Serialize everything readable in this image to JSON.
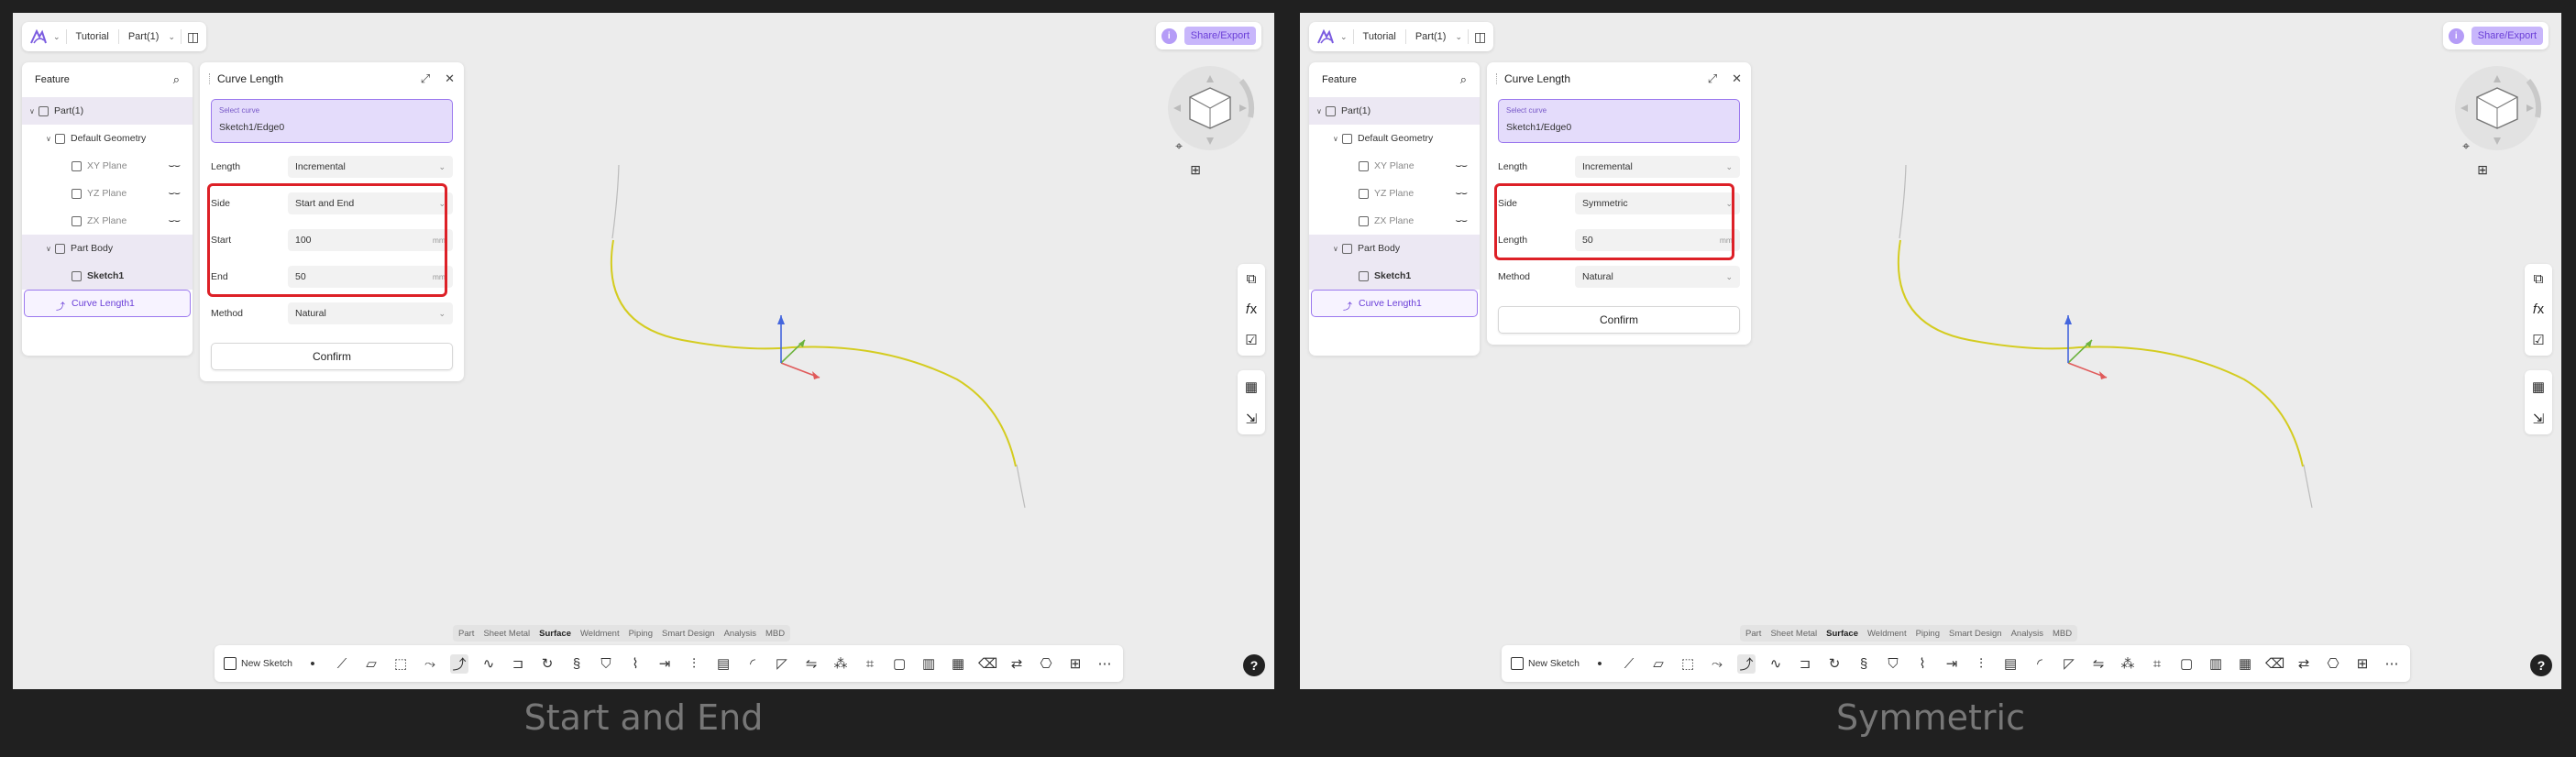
{
  "colors": {
    "accent": "#9b78ee",
    "highlight": "#dd2027",
    "curve": "#d4cc20",
    "axis_x": "#e05a5a",
    "axis_y": "#6cb33e",
    "axis_z": "#4466dd"
  },
  "screens": [
    {
      "caption": "Start and End",
      "topbar": {
        "logo_icon": "onshape-like-logo",
        "tutorial": "Tutorial",
        "part": "Part(1)",
        "share_label": "Share/Export",
        "info_label": "i"
      },
      "feature_panel": {
        "title": "Feature",
        "tree": [
          {
            "label": "Part(1)",
            "level": 0,
            "twisty": "v",
            "icon": "part-icon",
            "style": "sel"
          },
          {
            "label": "Default Geometry",
            "level": 1,
            "twisty": "v",
            "icon": "geometry-icon",
            "style": ""
          },
          {
            "label": "XY Plane",
            "level": 2,
            "twisty": "",
            "icon": "plane-icon",
            "style": "dim",
            "eye": true
          },
          {
            "label": "YZ Plane",
            "level": 2,
            "twisty": "",
            "icon": "plane-icon",
            "style": "dim",
            "eye": true
          },
          {
            "label": "ZX Plane",
            "level": 2,
            "twisty": "",
            "icon": "plane-icon",
            "style": "dim",
            "eye": true
          },
          {
            "label": "Part Body",
            "level": 1,
            "twisty": "v",
            "icon": "body-icon",
            "style": "sel"
          },
          {
            "label": "Sketch1",
            "level": 2,
            "twisty": "",
            "icon": "sketch-icon",
            "style": "sel bold"
          },
          {
            "label": "Curve Length1",
            "level": 1,
            "twisty": "",
            "icon": "curve-icon",
            "style": "active"
          }
        ]
      },
      "curve_panel": {
        "title": "Curve Length",
        "select_label": "Select curve",
        "select_value": "Sketch1/Edge0",
        "fields": [
          {
            "label": "Length",
            "kind": "dropdown",
            "value": "Incremental",
            "unit": ""
          },
          {
            "label": "Side",
            "kind": "dropdown",
            "value": "Start and End",
            "unit": ""
          },
          {
            "label": "Start",
            "kind": "input",
            "value": "100",
            "unit": "mm"
          },
          {
            "label": "End",
            "kind": "input",
            "value": "50",
            "unit": "mm"
          },
          {
            "label": "Method",
            "kind": "dropdown",
            "value": "Natural",
            "unit": ""
          }
        ],
        "highlight_rows": [
          1,
          3
        ],
        "confirm": "Confirm"
      },
      "modules": [
        "Part",
        "Sheet Metal",
        "Surface",
        "Weldment",
        "Piping",
        "Smart Design",
        "Analysis",
        "MBD"
      ],
      "active_module": "Surface",
      "toolbar": {
        "new_sketch": "New Sketch"
      },
      "help": "?"
    },
    {
      "caption": "Symmetric",
      "topbar": {
        "logo_icon": "onshape-like-logo",
        "tutorial": "Tutorial",
        "part": "Part(1)",
        "share_label": "Share/Export",
        "info_label": "i"
      },
      "feature_panel": {
        "title": "Feature",
        "tree": [
          {
            "label": "Part(1)",
            "level": 0,
            "twisty": "v",
            "icon": "part-icon",
            "style": "sel"
          },
          {
            "label": "Default Geometry",
            "level": 1,
            "twisty": "v",
            "icon": "geometry-icon",
            "style": ""
          },
          {
            "label": "XY Plane",
            "level": 2,
            "twisty": "",
            "icon": "plane-icon",
            "style": "dim",
            "eye": true
          },
          {
            "label": "YZ Plane",
            "level": 2,
            "twisty": "",
            "icon": "plane-icon",
            "style": "dim",
            "eye": true
          },
          {
            "label": "ZX Plane",
            "level": 2,
            "twisty": "",
            "icon": "plane-icon",
            "style": "dim",
            "eye": true
          },
          {
            "label": "Part Body",
            "level": 1,
            "twisty": "v",
            "icon": "body-icon",
            "style": "sel"
          },
          {
            "label": "Sketch1",
            "level": 2,
            "twisty": "",
            "icon": "sketch-icon",
            "style": "sel bold"
          },
          {
            "label": "Curve Length1",
            "level": 1,
            "twisty": "",
            "icon": "curve-icon",
            "style": "active"
          }
        ]
      },
      "curve_panel": {
        "title": "Curve Length",
        "select_label": "Select curve",
        "select_value": "Sketch1/Edge0",
        "fields": [
          {
            "label": "Length",
            "kind": "dropdown",
            "value": "Incremental",
            "unit": ""
          },
          {
            "label": "Side",
            "kind": "dropdown",
            "value": "Symmetric",
            "unit": ""
          },
          {
            "label": "Length",
            "kind": "input",
            "value": "50",
            "unit": "mm"
          },
          {
            "label": "Method",
            "kind": "dropdown",
            "value": "Natural",
            "unit": ""
          }
        ],
        "highlight_rows": [
          1,
          2
        ],
        "confirm": "Confirm"
      },
      "modules": [
        "Part",
        "Sheet Metal",
        "Surface",
        "Weldment",
        "Piping",
        "Smart Design",
        "Analysis",
        "MBD"
      ],
      "active_module": "Surface",
      "toolbar": {
        "new_sketch": "New Sketch"
      },
      "help": "?"
    }
  ],
  "toolbar_icons": [
    "point-icon",
    "line-icon",
    "plane-icon",
    "loft-icon",
    "extrude-icon",
    "curve-length-icon",
    "spline-icon",
    "offset-icon",
    "revolve-icon",
    "sweep-icon",
    "fill-icon",
    "trim-icon",
    "extend-icon",
    "split-icon",
    "thicken-icon",
    "fillet-icon",
    "chamfer-icon",
    "mirror-icon",
    "pattern-icon",
    "knit-icon",
    "boundary-icon",
    "ruled-icon",
    "patch-icon",
    "delete-face-icon",
    "replace-icon",
    "wrap-icon",
    "measure-icon",
    "more-icon"
  ],
  "side_icons": [
    "params-icon",
    "formula-icon",
    "checklist-icon",
    "table-icon",
    "transform-icon"
  ]
}
